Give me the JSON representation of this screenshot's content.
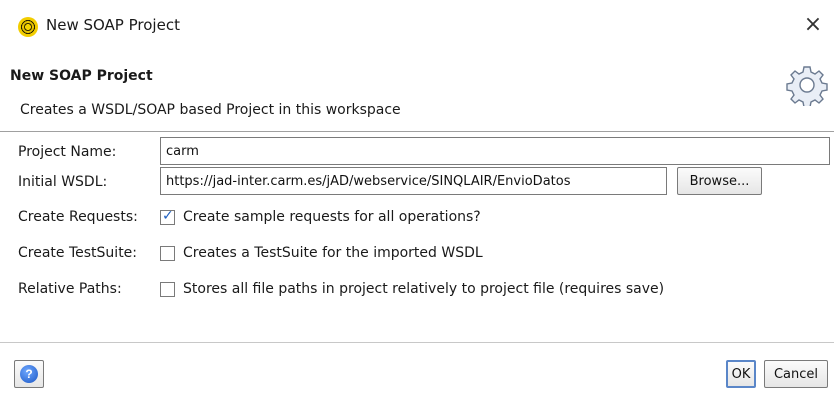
{
  "window": {
    "title": "New SOAP Project",
    "close_symbol": "×",
    "icon": "soapui-app-icon"
  },
  "header": {
    "title": "New SOAP Project",
    "description": "Creates a WSDL/SOAP based Project in this workspace",
    "icon": "gear-icon"
  },
  "form": {
    "project_name": {
      "label": "Project Name:",
      "value": "carm"
    },
    "initial_wsdl": {
      "label": "Initial WSDL:",
      "value": "https://jad-inter.carm.es/jAD/webservice/SINQLAIR/EnvioDatos",
      "browse_label": "Browse..."
    },
    "create_requests": {
      "label": "Create Requests:",
      "text": "Create sample requests for all operations?",
      "checked": true
    },
    "create_testsuite": {
      "label": "Create TestSuite:",
      "text": "Creates a TestSuite for the imported WSDL",
      "checked": false
    },
    "relative_paths": {
      "label": "Relative Paths:",
      "text": "Stores all file paths in project relatively to project file (requires save)",
      "checked": false
    }
  },
  "footer": {
    "help_symbol": "?",
    "ok_label": "OK",
    "cancel_label": "Cancel"
  }
}
